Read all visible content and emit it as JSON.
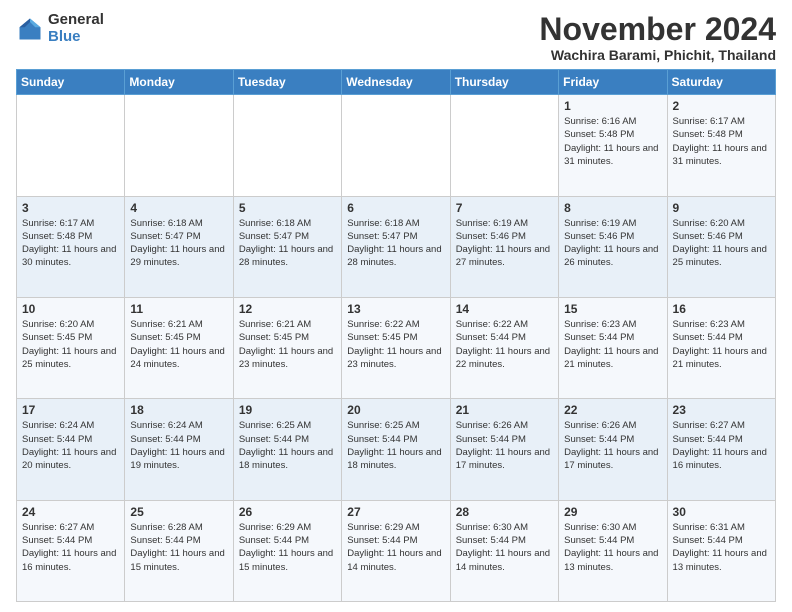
{
  "logo": {
    "general": "General",
    "blue": "Blue"
  },
  "header": {
    "month": "November 2024",
    "location": "Wachira Barami, Phichit, Thailand"
  },
  "weekdays": [
    "Sunday",
    "Monday",
    "Tuesday",
    "Wednesday",
    "Thursday",
    "Friday",
    "Saturday"
  ],
  "weeks": [
    [
      {
        "day": "",
        "info": ""
      },
      {
        "day": "",
        "info": ""
      },
      {
        "day": "",
        "info": ""
      },
      {
        "day": "",
        "info": ""
      },
      {
        "day": "",
        "info": ""
      },
      {
        "day": "1",
        "info": "Sunrise: 6:16 AM\nSunset: 5:48 PM\nDaylight: 11 hours and 31 minutes."
      },
      {
        "day": "2",
        "info": "Sunrise: 6:17 AM\nSunset: 5:48 PM\nDaylight: 11 hours and 31 minutes."
      }
    ],
    [
      {
        "day": "3",
        "info": "Sunrise: 6:17 AM\nSunset: 5:48 PM\nDaylight: 11 hours and 30 minutes."
      },
      {
        "day": "4",
        "info": "Sunrise: 6:18 AM\nSunset: 5:47 PM\nDaylight: 11 hours and 29 minutes."
      },
      {
        "day": "5",
        "info": "Sunrise: 6:18 AM\nSunset: 5:47 PM\nDaylight: 11 hours and 28 minutes."
      },
      {
        "day": "6",
        "info": "Sunrise: 6:18 AM\nSunset: 5:47 PM\nDaylight: 11 hours and 28 minutes."
      },
      {
        "day": "7",
        "info": "Sunrise: 6:19 AM\nSunset: 5:46 PM\nDaylight: 11 hours and 27 minutes."
      },
      {
        "day": "8",
        "info": "Sunrise: 6:19 AM\nSunset: 5:46 PM\nDaylight: 11 hours and 26 minutes."
      },
      {
        "day": "9",
        "info": "Sunrise: 6:20 AM\nSunset: 5:46 PM\nDaylight: 11 hours and 25 minutes."
      }
    ],
    [
      {
        "day": "10",
        "info": "Sunrise: 6:20 AM\nSunset: 5:45 PM\nDaylight: 11 hours and 25 minutes."
      },
      {
        "day": "11",
        "info": "Sunrise: 6:21 AM\nSunset: 5:45 PM\nDaylight: 11 hours and 24 minutes."
      },
      {
        "day": "12",
        "info": "Sunrise: 6:21 AM\nSunset: 5:45 PM\nDaylight: 11 hours and 23 minutes."
      },
      {
        "day": "13",
        "info": "Sunrise: 6:22 AM\nSunset: 5:45 PM\nDaylight: 11 hours and 23 minutes."
      },
      {
        "day": "14",
        "info": "Sunrise: 6:22 AM\nSunset: 5:44 PM\nDaylight: 11 hours and 22 minutes."
      },
      {
        "day": "15",
        "info": "Sunrise: 6:23 AM\nSunset: 5:44 PM\nDaylight: 11 hours and 21 minutes."
      },
      {
        "day": "16",
        "info": "Sunrise: 6:23 AM\nSunset: 5:44 PM\nDaylight: 11 hours and 21 minutes."
      }
    ],
    [
      {
        "day": "17",
        "info": "Sunrise: 6:24 AM\nSunset: 5:44 PM\nDaylight: 11 hours and 20 minutes."
      },
      {
        "day": "18",
        "info": "Sunrise: 6:24 AM\nSunset: 5:44 PM\nDaylight: 11 hours and 19 minutes."
      },
      {
        "day": "19",
        "info": "Sunrise: 6:25 AM\nSunset: 5:44 PM\nDaylight: 11 hours and 18 minutes."
      },
      {
        "day": "20",
        "info": "Sunrise: 6:25 AM\nSunset: 5:44 PM\nDaylight: 11 hours and 18 minutes."
      },
      {
        "day": "21",
        "info": "Sunrise: 6:26 AM\nSunset: 5:44 PM\nDaylight: 11 hours and 17 minutes."
      },
      {
        "day": "22",
        "info": "Sunrise: 6:26 AM\nSunset: 5:44 PM\nDaylight: 11 hours and 17 minutes."
      },
      {
        "day": "23",
        "info": "Sunrise: 6:27 AM\nSunset: 5:44 PM\nDaylight: 11 hours and 16 minutes."
      }
    ],
    [
      {
        "day": "24",
        "info": "Sunrise: 6:27 AM\nSunset: 5:44 PM\nDaylight: 11 hours and 16 minutes."
      },
      {
        "day": "25",
        "info": "Sunrise: 6:28 AM\nSunset: 5:44 PM\nDaylight: 11 hours and 15 minutes."
      },
      {
        "day": "26",
        "info": "Sunrise: 6:29 AM\nSunset: 5:44 PM\nDaylight: 11 hours and 15 minutes."
      },
      {
        "day": "27",
        "info": "Sunrise: 6:29 AM\nSunset: 5:44 PM\nDaylight: 11 hours and 14 minutes."
      },
      {
        "day": "28",
        "info": "Sunrise: 6:30 AM\nSunset: 5:44 PM\nDaylight: 11 hours and 14 minutes."
      },
      {
        "day": "29",
        "info": "Sunrise: 6:30 AM\nSunset: 5:44 PM\nDaylight: 11 hours and 13 minutes."
      },
      {
        "day": "30",
        "info": "Sunrise: 6:31 AM\nSunset: 5:44 PM\nDaylight: 11 hours and 13 minutes."
      }
    ]
  ]
}
